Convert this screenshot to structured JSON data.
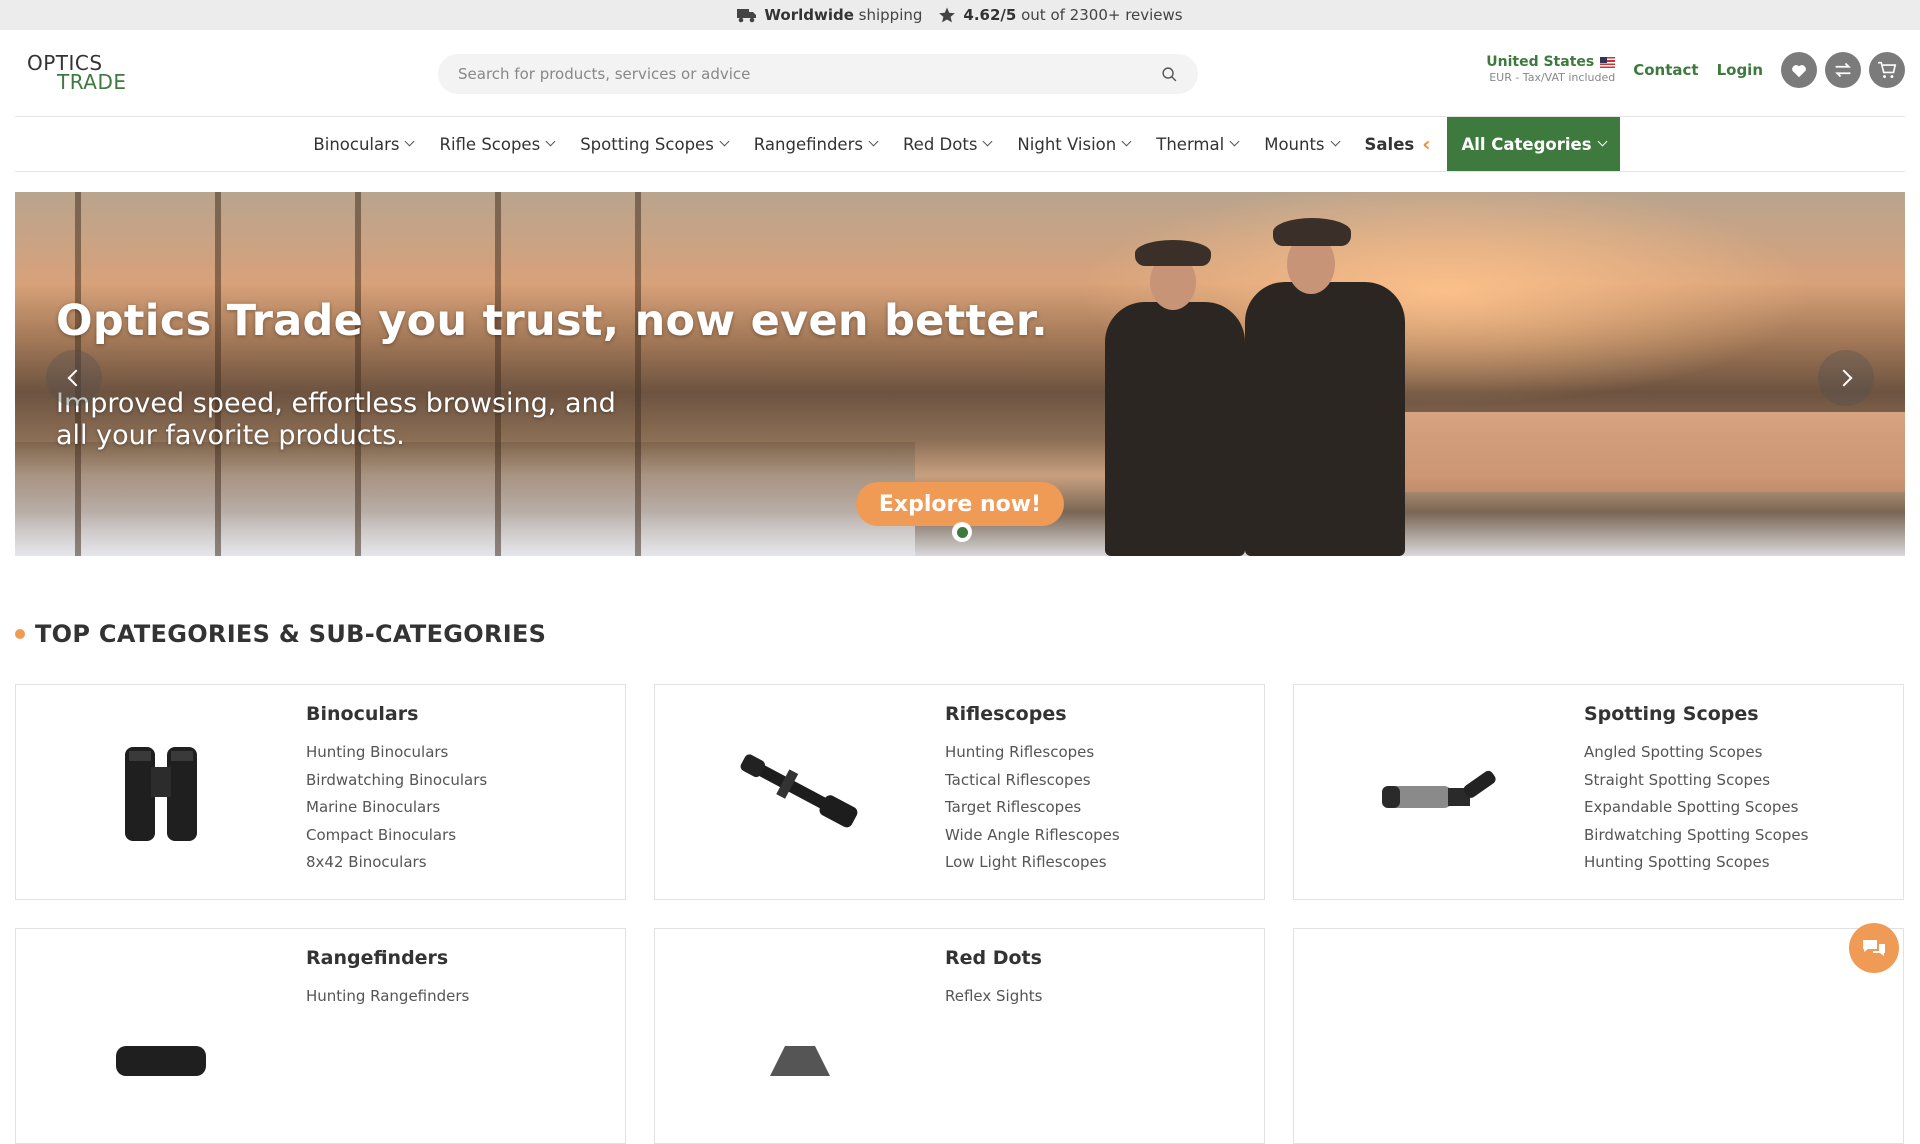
{
  "topbar": {
    "shipping_bold": "Worldwide",
    "shipping_text": "shipping",
    "rating_bold": "4.62/5",
    "rating_text": "out of 2300+ reviews"
  },
  "header": {
    "logo_line1": "OPTICS",
    "logo_line2": "TRADE",
    "search_placeholder": "Search for products, services or advice",
    "country": "United States",
    "currency_note": "EUR - Tax/VAT included",
    "contact": "Contact",
    "login": "Login"
  },
  "nav": {
    "items": [
      "Binoculars",
      "Rifle Scopes",
      "Spotting Scopes",
      "Rangefinders",
      "Red Dots",
      "Night Vision",
      "Thermal",
      "Mounts"
    ],
    "sales": "Sales",
    "all_categories": "All Categories"
  },
  "hero": {
    "title": "Optics Trade you trust, now even better.",
    "subtitle": "Improved speed, effortless browsing, and all your favorite products.",
    "cta": "Explore now!"
  },
  "section": {
    "title": "TOP CATEGORIES & SUB-CATEGORIES"
  },
  "categories": [
    {
      "title": "Binoculars",
      "icon": "binoculars-image",
      "links": [
        "Hunting Binoculars",
        "Birdwatching Binoculars",
        "Marine Binoculars",
        "Compact Binoculars",
        "8x42 Binoculars"
      ]
    },
    {
      "title": "Riflescopes",
      "icon": "riflescope-image",
      "links": [
        "Hunting Riflescopes",
        "Tactical Riflescopes",
        "Target Riflescopes",
        "Wide Angle Riflescopes",
        "Low Light Riflescopes"
      ]
    },
    {
      "title": "Spotting Scopes",
      "icon": "spotting-scope-image",
      "links": [
        "Angled Spotting Scopes",
        "Straight Spotting Scopes",
        "Expandable Spotting Scopes",
        "Birdwatching Spotting Scopes",
        "Hunting Spotting Scopes"
      ]
    },
    {
      "title": "Rangefinders",
      "icon": "rangefinder-image",
      "links": [
        "Hunting Rangefinders"
      ]
    },
    {
      "title": "Red Dots",
      "icon": "red-dot-image",
      "links": [
        "Reflex Sights"
      ]
    },
    {
      "title": "",
      "icon": "category-image",
      "links": []
    }
  ],
  "colors": {
    "brand_green": "#3e7a3e",
    "accent_orange": "#ef9a55"
  }
}
